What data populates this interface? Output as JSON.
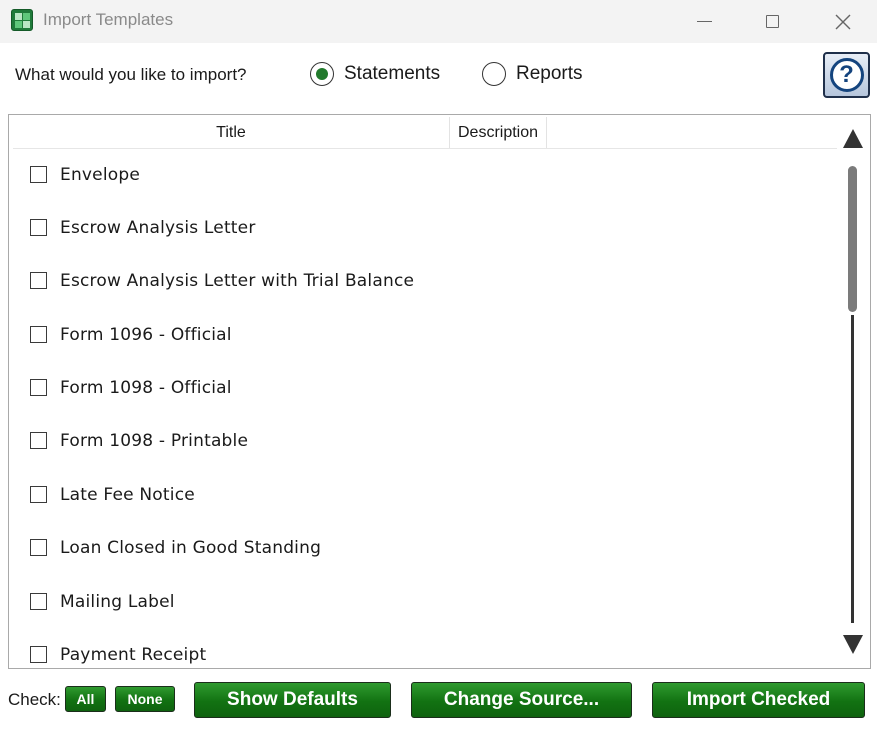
{
  "window": {
    "title": "Import Templates",
    "accent_color": "#127212"
  },
  "import": {
    "question": "What would you like to import?",
    "options": [
      {
        "label": "Statements",
        "selected": true
      },
      {
        "label": "Reports",
        "selected": false
      }
    ],
    "help_label": "?"
  },
  "table": {
    "columns": [
      "Title",
      "Description"
    ],
    "rows": [
      {
        "title": "Envelope",
        "checked": false
      },
      {
        "title": "Escrow Analysis Letter",
        "checked": false
      },
      {
        "title": "Escrow Analysis Letter with Trial Balance",
        "checked": false
      },
      {
        "title": "Form 1096 - Official",
        "checked": false
      },
      {
        "title": "Form 1098 - Official",
        "checked": false
      },
      {
        "title": "Form 1098 - Printable",
        "checked": false
      },
      {
        "title": "Late Fee Notice",
        "checked": false
      },
      {
        "title": "Loan Closed in Good Standing",
        "checked": false
      },
      {
        "title": "Mailing Label",
        "checked": false
      },
      {
        "title": "Payment Receipt",
        "checked": false
      }
    ]
  },
  "footer": {
    "check_label": "Check:",
    "all_label": "All",
    "none_label": "None",
    "show_defaults_label": "Show Defaults",
    "change_source_label": "Change Source...",
    "import_checked_label": "Import Checked"
  },
  "icons": {
    "app": "spreadsheet-app-icon",
    "minimize": "minimize-icon",
    "maximize": "maximize-icon",
    "close": "close-icon",
    "help": "help-icon",
    "scroll_up": "arrow-up-icon",
    "scroll_down": "arrow-down-icon"
  }
}
